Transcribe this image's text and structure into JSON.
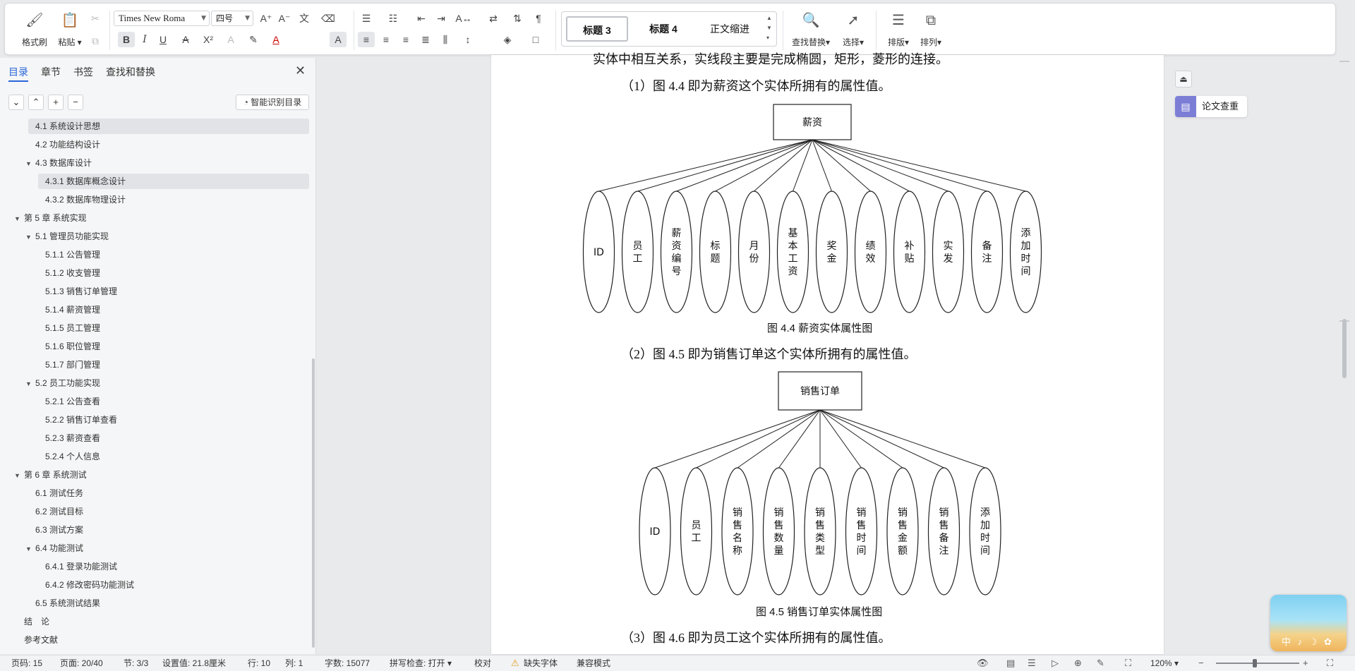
{
  "toolbar": {
    "format_painter": "格式刷",
    "paste": "粘贴",
    "font_name": "Times New Roma",
    "font_size": "四号",
    "styles": [
      "标题 3",
      "标题 4",
      "正文缩进"
    ],
    "find_replace": "查找替换",
    "select": "选择",
    "layout": "排版",
    "arrange": "排列"
  },
  "nav": {
    "tabs": [
      "目录",
      "章节",
      "书签",
      "查找和替换"
    ],
    "close": "✕",
    "controls": [
      "⌄",
      "⌃",
      "+",
      "−"
    ],
    "smart_toc": "智能识别目录",
    "toc": [
      {
        "label": "4.1  系统设计思想",
        "level": 2,
        "highlight": true
      },
      {
        "label": "4.2  功能结构设计",
        "level": 2
      },
      {
        "label": "4.3  数据库设计",
        "level": 2,
        "arrow": "▼"
      },
      {
        "label": "4.3.1  数据库概念设计",
        "level": 3,
        "highlight": true
      },
      {
        "label": "4.3.2  数据库物理设计",
        "level": 3
      },
      {
        "label": "第 5 章  系统实现",
        "level": 1,
        "arrow": "▼"
      },
      {
        "label": "5.1  管理员功能实现",
        "level": 2,
        "arrow": "▼"
      },
      {
        "label": "5.1.1  公告管理",
        "level": 3
      },
      {
        "label": "5.1.2  收支管理",
        "level": 3
      },
      {
        "label": "5.1.3  销售订单管理",
        "level": 3
      },
      {
        "label": "5.1.4  薪资管理",
        "level": 3
      },
      {
        "label": "5.1.5  员工管理",
        "level": 3
      },
      {
        "label": "5.1.6  职位管理",
        "level": 3
      },
      {
        "label": "5.1.7  部门管理",
        "level": 3
      },
      {
        "label": "5.2  员工功能实现",
        "level": 2,
        "arrow": "▼"
      },
      {
        "label": "5.2.1  公告查看",
        "level": 3
      },
      {
        "label": "5.2.2  销售订单查看",
        "level": 3
      },
      {
        "label": "5.2.3  薪资查看",
        "level": 3
      },
      {
        "label": "5.2.4  个人信息",
        "level": 3
      },
      {
        "label": "第 6 章  系统测试",
        "level": 1,
        "arrow": "▼"
      },
      {
        "label": "6.1  测试任务",
        "level": 2
      },
      {
        "label": "6.2  测试目标",
        "level": 2
      },
      {
        "label": "6.3  测试方案",
        "level": 2
      },
      {
        "label": "6.4  功能测试",
        "level": 2,
        "arrow": "▼"
      },
      {
        "label": "6.4.1  登录功能测试",
        "level": 3
      },
      {
        "label": "6.4.2  修改密码功能测试",
        "level": 3
      },
      {
        "label": "6.5  系统测试结果",
        "level": 2
      },
      {
        "label": "结　论",
        "level": 1
      },
      {
        "label": "参考文献",
        "level": 1
      }
    ]
  },
  "document": {
    "top_line": "实体中相互关系，实线段主要是完成椭圆，矩形，菱形的连接。",
    "p1": "（1）图 4.4 即为薪资这个实体所拥有的属性值。",
    "entity1": "薪资",
    "attrs1": [
      "ID",
      "员工",
      "薪资编号",
      "标题",
      "月份",
      "基本工资",
      "奖金",
      "绩效",
      "补贴",
      "实发",
      "备注",
      "添加时间"
    ],
    "caption1": "图 4.4  薪资实体属性图",
    "p2": "（2）图 4.5 即为销售订单这个实体所拥有的属性值。",
    "entity2": "销售订单",
    "attrs2": [
      "ID",
      "员工",
      "销售名称",
      "销售数量",
      "销售类型",
      "销售时间",
      "销售金额",
      "销售备注",
      "添加时间"
    ],
    "caption2": "图 4.5  销售订单实体属性图",
    "p3": "（3）图 4.6 即为员工这个实体所拥有的属性值。"
  },
  "right_pane": {
    "paper_check": "论文查重",
    "widget_text": "中 ♪ ☽ ✿"
  },
  "status": {
    "page_code": "页码: 15",
    "page": "页面: 20/40",
    "section": "节: 3/3",
    "set_value": "设置值: 21.8厘米",
    "row": "行: 10",
    "col": "列: 1",
    "word_count": "字数: 15077",
    "spell_check": "拼写检查: 打开",
    "proofread": "校对",
    "missing_font": "缺失字体",
    "compat_mode": "兼容模式",
    "zoom": "120%"
  }
}
